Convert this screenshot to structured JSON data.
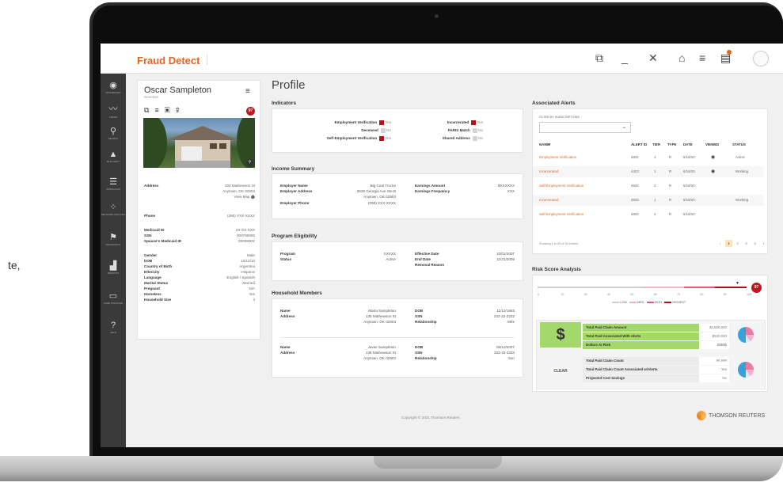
{
  "left_text": "te,",
  "app": {
    "title": "Fraud Detect"
  },
  "topbar_icons": [
    "open-external-icon",
    "minimize-icon",
    "close-icon",
    "briefcase-icon",
    "list-icon",
    "notification-icon"
  ],
  "sidebar": {
    "items": [
      {
        "icon": "dashboard-icon",
        "label": "DASHBOARD"
      },
      {
        "icon": "trends-icon",
        "label": "TREND"
      },
      {
        "icon": "search-icon",
        "label": "SEARCH"
      },
      {
        "icon": "alert-icon",
        "label": "FILE ALERT"
      },
      {
        "icon": "workload-icon",
        "label": "WORKLOAD"
      },
      {
        "icon": "network-icon",
        "label": "NETWORK ANALYSIS"
      },
      {
        "icon": "geography-icon",
        "label": "GEOGRAPHY"
      },
      {
        "icon": "reports-icon",
        "label": "REPORTS"
      },
      {
        "icon": "case-icon",
        "label": "CASE TRACKING"
      },
      {
        "icon": "help-icon",
        "label": "HELP"
      }
    ]
  },
  "recipient": {
    "name": "Oscar Sampleton",
    "role": "RECIPIENT",
    "score": "97",
    "address_label": "Address",
    "address_line1": "333 Mathewson St",
    "address_line2": "Anytown, OK 02903",
    "view_map": "View Map",
    "fields_a": [
      {
        "k": "Phone",
        "v": "(390) XXX-XXXX"
      }
    ],
    "fields_b": [
      {
        "k": "Medicaid ID",
        "v": "ZX-XX-XXX"
      },
      {
        "k": "SSN",
        "v": "000790000"
      },
      {
        "k": "Spouse's Medicaid ID",
        "v": "0000900X"
      }
    ],
    "fields_c": [
      {
        "k": "Gender",
        "v": "Male"
      },
      {
        "k": "DOB",
        "v": "10/12/10"
      },
      {
        "k": "Country of Birth",
        "v": "Argentina"
      },
      {
        "k": "Ethnicity",
        "v": "Hispanic"
      },
      {
        "k": "Language",
        "v": "English / Spanish"
      },
      {
        "k": "Marital Status",
        "v": "Married"
      },
      {
        "k": "Pregnant",
        "v": "N/A"
      },
      {
        "k": "Homeless",
        "v": "Yes"
      },
      {
        "k": "Household Size",
        "v": "3"
      }
    ]
  },
  "profile": {
    "heading": "Profile",
    "indicators_title": "Indicators",
    "indicators": [
      {
        "label": "Employment Verification",
        "value": "Yes",
        "flag": "red"
      },
      {
        "label": "Deceased",
        "value": "No",
        "flag": "grey"
      },
      {
        "label": "Self-Employment Verification",
        "value": "Yes",
        "flag": "red"
      },
      {
        "label": "Incarcerated",
        "value": "Yes",
        "flag": "red"
      },
      {
        "label": "PARIS Match",
        "value": "No",
        "flag": "grey"
      },
      {
        "label": "Shared Address",
        "value": "No",
        "flag": "grey"
      }
    ],
    "income_title": "Income Summary",
    "income": {
      "employer_name_label": "Employer Name",
      "employer_name": "Big Coat Trucks",
      "employer_address_label": "Employer Address",
      "employer_address1": "3536 Georgia Ave Ste B",
      "employer_address2": "Anytown, OK 02903",
      "employer_phone_label": "Employer Phone",
      "employer_phone": "(090) XXX-XXXX",
      "earnings_amount_label": "Earnings Amount",
      "earnings_amount": "$XXXXXX",
      "earnings_freq_label": "Earnings Frequency",
      "earnings_freq": "XXX"
    },
    "program_title": "Program Eligibility",
    "program": {
      "program_label": "Program",
      "program": "XXXXX",
      "status_label": "Status",
      "status": "Active",
      "effective_label": "Effective Date",
      "effective": "10/01/2007",
      "end_label": "End Date",
      "end": "12/31/2009",
      "removal_label": "Removal Reason",
      "removal": ""
    },
    "household_title": "Household Members",
    "household": [
      {
        "name_label": "Name",
        "name": "Maria Sampleton",
        "address_label": "Address",
        "address1": "135 Mathewson St",
        "address2": "Anytown, OK 02903",
        "dob_label": "DOB",
        "dob": "11/12/1965",
        "ssn_label": "SSN",
        "ssn": "222-22-2222",
        "rel_label": "Relationship",
        "rel": "Wife"
      },
      {
        "name_label": "Name",
        "name": "Javier Sampleton",
        "address_label": "Address",
        "address1": "135 Mathewson St",
        "address2": "Anytown, OK 02903",
        "dob_label": "DOB",
        "dob": "06/12/2007",
        "ssn_label": "SSN",
        "ssn": "333-33-3333",
        "rel_label": "Relationship",
        "rel": "Son"
      }
    ]
  },
  "alerts": {
    "title": "Associated Alerts",
    "filter_label": "FILTER BY SUBSCRIPTIONS",
    "columns": [
      "NAME",
      "ALERT ID",
      "TIER",
      "TYPE",
      "DATE",
      "VIEWED",
      "STATUS"
    ],
    "rows": [
      {
        "name": "Employment Verification",
        "id": "4831",
        "tier": "1",
        "type": "R",
        "date": "5/16/20",
        "viewed": true,
        "status": "Active"
      },
      {
        "name": "Incarcerated",
        "id": "4423",
        "tier": "1",
        "type": "R",
        "date": "6/16/20",
        "viewed": true,
        "status": "Working"
      },
      {
        "name": "Self-Employment Verification",
        "id": "4634",
        "tier": "2",
        "type": "R",
        "date": "5/16/20",
        "viewed": false,
        "status": ""
      },
      {
        "name": "Incarcerated",
        "id": "4833",
        "tier": "1",
        "type": "R",
        "date": "6/16/20",
        "viewed": false,
        "status": "Working"
      },
      {
        "name": "Self-Employment Verification",
        "id": "4834",
        "tier": "2",
        "type": "R",
        "date": "5/16/20",
        "viewed": false,
        "status": ""
      }
    ],
    "showing": "Showing 1 to 25 of 50 entries",
    "pages": [
      "1",
      "2",
      "3",
      "4"
    ]
  },
  "risk": {
    "title": "Risk Score Analysis",
    "score": "97",
    "scale_ticks": [
      "0",
      "10",
      "20",
      "40",
      "50",
      "60",
      "70",
      "80",
      "90",
      "100"
    ],
    "legend": [
      "LOW",
      "MED",
      "HIGH",
      "HIGHEST"
    ],
    "legend_colors": [
      "#cfcfcf",
      "#f3b2c9",
      "#e05a80",
      "#a8141c"
    ],
    "group1": [
      {
        "label": "Total Paid Claim Amount",
        "value": "$2,500,000"
      },
      {
        "label": "Total Paid Associated With Alerts",
        "value": "$520,000"
      },
      {
        "label": "Dollars At Risk",
        "value": "$$$$$"
      }
    ],
    "clear_label": "CLEAR",
    "group2": [
      {
        "label": "Total Paid Claim Count",
        "value": "##,###"
      },
      {
        "label": "Total Paid Claim Count Associated w/Alerts",
        "value": "Yes"
      },
      {
        "label": "Projected Cost Savings",
        "value": "No"
      }
    ]
  },
  "footer": {
    "copyright": "Copyright © 2021 Thomson Reuters",
    "logo": "THOMSON REUTERS"
  }
}
